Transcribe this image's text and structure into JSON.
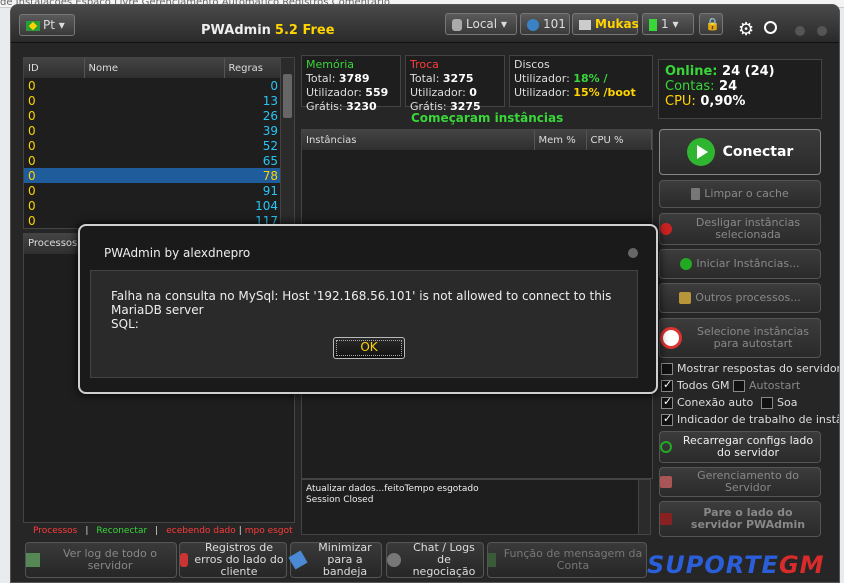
{
  "background_strip": "de Instalações   Espaço Livre   Gerenciamento Automático   Registros   Comentário",
  "titlebar": {
    "language": "Pt",
    "app_name": "PWAdmin",
    "version": "5.2 Free",
    "server": "Local",
    "online_count": "101",
    "user": "Mukas",
    "slot": "1"
  },
  "instances_table": {
    "headers": [
      "ID",
      "Nome",
      "Regras"
    ],
    "rows": [
      {
        "id": "0",
        "nome": "",
        "regras": "0"
      },
      {
        "id": "0",
        "nome": "",
        "regras": "13"
      },
      {
        "id": "0",
        "nome": "",
        "regras": "26"
      },
      {
        "id": "0",
        "nome": "",
        "regras": "39"
      },
      {
        "id": "0",
        "nome": "",
        "regras": "52"
      },
      {
        "id": "0",
        "nome": "",
        "regras": "65"
      },
      {
        "id": "0",
        "nome": "",
        "regras": "78"
      },
      {
        "id": "0",
        "nome": "",
        "regras": "91"
      },
      {
        "id": "0",
        "nome": "",
        "regras": "104"
      },
      {
        "id": "0",
        "nome": "",
        "regras": "117"
      }
    ],
    "selected_index": 6
  },
  "processes_label": "Processos",
  "memory": {
    "title": "Memória",
    "total_label": "Total:",
    "total": "3789",
    "used_label": "Utilizador:",
    "used": "559",
    "free_label": "Grátis:",
    "free": "3230"
  },
  "swap": {
    "title": "Troca",
    "total_label": "Total:",
    "total": "3275",
    "used_label": "Utilizador:",
    "used": "0",
    "free_label": "Grátis:",
    "free": "3275"
  },
  "disks": {
    "title": "Discos",
    "line1_label": "Utilizador:",
    "line1_value": "18% /",
    "line2_label": "Utilizador:",
    "line2_value": "15% /boot"
  },
  "status_text": "Começaram instâncias",
  "instances_panel": {
    "headers": [
      "Instâncias",
      "Mem %",
      "CPU %"
    ]
  },
  "server_info": {
    "online_label": "Online:",
    "online_value": "24 (24)",
    "accounts_label": "Contas:",
    "accounts_value": "24",
    "cpu_label": "CPU:",
    "cpu_value": "0,90%"
  },
  "connect_label": "Conectar",
  "side_buttons": {
    "clear_cache": "Limpar o cache",
    "stop_instances": "Desligar instâncias selecionada",
    "start_instances": "Iniciar Instâncias...",
    "other_processes": "Outros processos...",
    "autostart": "Selecione instâncias para autostart"
  },
  "checkboxes": {
    "show_responses": "Mostrar respostas do servidor",
    "all_gm": "Todos GM",
    "autostart": "Autostart",
    "auto_connect": "Conexão auto",
    "sound": "Soa",
    "work_indicator": "Indicador de trabalho de instân"
  },
  "reload_configs": "Recarregar configs lado do servidor",
  "server_management": "Gerenciamento do Servidor",
  "stop_server": "Pare o lado do servidor PWAdmin",
  "log_lines": [
    "Atualizar dados...feitoTempo esgotado",
    "Session Closed"
  ],
  "legend": {
    "processes": "Processos",
    "connect": "Reconectar",
    "receiving": "ecebendo dado",
    "timeout": "mpo esgot"
  },
  "bottom_buttons": {
    "view_log": "Ver log de todo o servidor",
    "error_logs": "Registros de erros do lado do cliente",
    "minimize": "Minimizar para a bandeja",
    "chat_logs": "Chat / Logs de negociação",
    "message_function": "Função de mensagem da Conta"
  },
  "watermark": {
    "part1": "SUPORTE",
    "part2": "GM"
  },
  "dialog": {
    "title": "PWAdmin by alexdnepro",
    "message_line1": "Falha na consulta no MySql: Host '192.168.56.101' is not allowed to connect to this MariaDB server",
    "message_line2": "SQL:",
    "ok_label": "OK"
  },
  "colors": {
    "accent_yellow": "#ffd400",
    "green": "#38d638",
    "red": "#ff3a3a",
    "blue": "#29c5f6",
    "selection": "#1f5c9c"
  }
}
